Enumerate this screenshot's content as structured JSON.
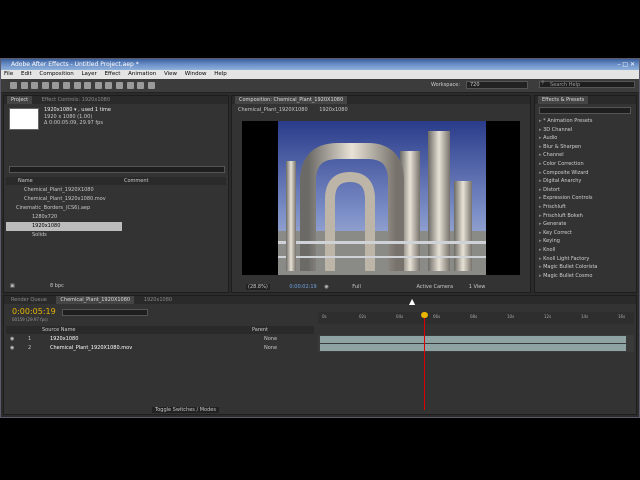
{
  "app": {
    "title": "Adobe After Effects - Untitled Project.aep *",
    "menu": [
      "File",
      "Edit",
      "Composition",
      "Layer",
      "Effect",
      "Animation",
      "View",
      "Window",
      "Help"
    ],
    "workspace_label": "Workspace:",
    "workspace_value": "720",
    "search_help_placeholder": "Search Help"
  },
  "project": {
    "tab_project": "Project",
    "tab_effect_controls": "Effect Controls: 1920x1080",
    "item_title": "1920x1080 ▾ , used 1 time",
    "item_detail1": "1920 x 1080 (1.00)",
    "item_detail2": "Δ 0:00:05:09, 29.97 fps",
    "col_name": "Name",
    "col_comment": "Comment",
    "items": [
      "Chemical_Plant_1920X1080",
      "Chemical_Plant_1920x1080.mov",
      "Cinematic_Borders_(CS6).aep",
      "1280x720",
      "1920x1080",
      "Solids"
    ],
    "bpc": "8 bpc"
  },
  "composition": {
    "tab_label": "Composition: Chemical_Plant_1920X1080",
    "subtab1": "Chemical_Plant_1920X1080",
    "subtab2": "1920x1080",
    "zoom": "(28.8%)",
    "timecode": "0:00:02:19",
    "resolution": "Full",
    "camera": "Active Camera",
    "view": "1 View"
  },
  "effects": {
    "tab_label": "Effects & Presets",
    "search_placeholder": "",
    "items": [
      "* Animation Presets",
      "3D Channel",
      "Audio",
      "Blur & Sharpen",
      "Channel",
      "Color Correction",
      "Composite Wizard",
      "Digital Anarchy",
      "Distort",
      "Expression Controls",
      "Frischluft",
      "Frischluft Bokeh",
      "Generate",
      "Key Correct",
      "Keying",
      "Knoll",
      "Knoll Light Factory",
      "Magic Bullet Colorista",
      "Magic Bullet Cosmo"
    ]
  },
  "timeline": {
    "tab_render": "Render Queue",
    "tab_comp1": "Chemical_Plant_1920X1080",
    "tab_comp2": "1920x1080",
    "timecode": "0:00:05:19",
    "frame_info": "00159 (29.97 fps)",
    "col_source": "Source Name",
    "col_parent": "Parent",
    "layers": [
      {
        "num": "1",
        "name": "1920x1080",
        "parent": "None"
      },
      {
        "num": "2",
        "name": "Chemical_Plant_1920X1080.mov",
        "parent": "None"
      }
    ],
    "ruler_ticks": [
      "0s",
      "02s",
      "04s",
      "06s",
      "08s",
      "10s",
      "12s",
      "14s",
      "16s"
    ],
    "toggle_label": "Toggle Switches / Modes",
    "playhead_fraction": 0.34
  },
  "colors": {
    "timecode": "#e8b400",
    "playhead": "#dd0000",
    "layer_bar": "#8fa3a3",
    "titlebar": "#5b82c0"
  }
}
